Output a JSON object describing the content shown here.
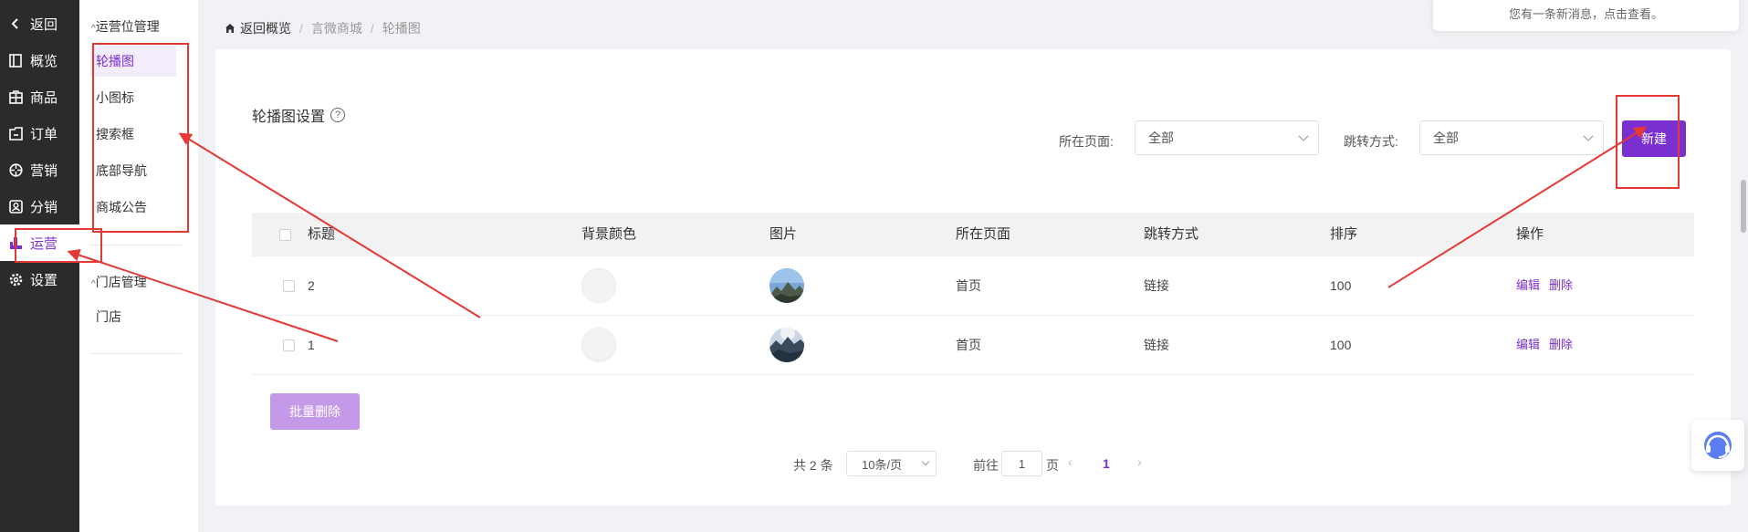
{
  "leftbar": {
    "items": [
      {
        "label": "返回",
        "icon": "chevron-left-icon"
      },
      {
        "label": "概览",
        "icon": "overview-icon"
      },
      {
        "label": "商品",
        "icon": "goods-icon"
      },
      {
        "label": "订单",
        "icon": "order-icon"
      },
      {
        "label": "营销",
        "icon": "marketing-icon"
      },
      {
        "label": "分销",
        "icon": "distribution-icon"
      },
      {
        "label": "运营",
        "icon": "operation-icon"
      },
      {
        "label": "设置",
        "icon": "gear-icon"
      }
    ],
    "active_index": 6
  },
  "submenu": {
    "group1": "运营位管理",
    "items1": [
      "轮播图",
      "小图标",
      "搜索框",
      "底部导航",
      "商城公告"
    ],
    "group2": "门店管理",
    "items2": [
      "门店"
    ]
  },
  "breadcrumb": [
    "返回概览",
    "言微商城",
    "轮播图"
  ],
  "notice": "您有一条新消息，点击查看。",
  "card": {
    "title": "轮播图设置",
    "help": "?",
    "filter_page_label": "所在页面:",
    "filter_page_value": "全部",
    "filter_jump_label": "跳转方式:",
    "filter_jump_value": "全部",
    "new_button": "新建"
  },
  "table": {
    "headers": [
      "标题",
      "背景颜色",
      "图片",
      "所在页面",
      "跳转方式",
      "排序",
      "操作"
    ],
    "rows": [
      {
        "title": "2",
        "page": "首页",
        "jump": "链接",
        "sort": "100",
        "edit": "编辑",
        "delete": "删除"
      },
      {
        "title": "1",
        "page": "首页",
        "jump": "链接",
        "sort": "100",
        "edit": "编辑",
        "delete": "删除"
      }
    ]
  },
  "batch_delete": "批量删除",
  "pagination": {
    "total": "共 2 条",
    "page_size": "10条/页",
    "goto_label": "前往",
    "goto_value": "1",
    "page_unit": "页",
    "current_page": "1"
  },
  "colors": {
    "accent": "#7a2fd0",
    "annotation": "#e53935",
    "sidebar_bg": "#2b2b2b"
  }
}
